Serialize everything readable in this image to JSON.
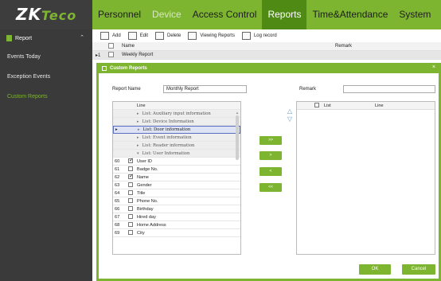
{
  "brand": {
    "logo_main": "ZK",
    "logo_accent": "Teco"
  },
  "topnav": [
    {
      "label": "Personnel",
      "state": "normal"
    },
    {
      "label": "Device",
      "state": "muted"
    },
    {
      "label": "Access Control",
      "state": "normal"
    },
    {
      "label": "Reports",
      "state": "active"
    },
    {
      "label": "Time&Attendance",
      "state": "normal"
    },
    {
      "label": "System",
      "state": "normal"
    }
  ],
  "sidebar": {
    "header": "Report",
    "items": [
      {
        "label": "Events Today",
        "active": false
      },
      {
        "label": "Exception Events",
        "active": false
      },
      {
        "label": "Custom Reports",
        "active": true
      }
    ]
  },
  "toolbar": {
    "add": "Add",
    "edit": "Edit",
    "delete": "Delete",
    "view": "Viewing Reports",
    "log": "Log record"
  },
  "main_table": {
    "headers": {
      "name": "Name",
      "remark": "Remark"
    },
    "rows": [
      {
        "index": "1",
        "name": "Weekly Report",
        "remark": ""
      }
    ]
  },
  "dialog": {
    "title": "Custom Reports",
    "close": "×",
    "report_name_label": "Report Name",
    "report_name_value": "Monthly Report",
    "remark_label": "Remark",
    "remark_value": "",
    "left_grid": {
      "header": "Line",
      "groups": [
        "List: Auxiliary input information",
        "List: Device Information",
        "List: Door information",
        "List: Event information",
        "List: Reader information",
        "List: User Information"
      ],
      "current_group": 2,
      "expanded_group": 5,
      "items": [
        {
          "num": "60",
          "label": "User ID",
          "checked": true
        },
        {
          "num": "61",
          "label": "Badge No.",
          "checked": false
        },
        {
          "num": "62",
          "label": "Name",
          "checked": true
        },
        {
          "num": "63",
          "label": "Gender",
          "checked": false
        },
        {
          "num": "64",
          "label": "Title",
          "checked": false
        },
        {
          "num": "65",
          "label": "Phone No.",
          "checked": false
        },
        {
          "num": "66",
          "label": "Birthday",
          "checked": false
        },
        {
          "num": "67",
          "label": "Hired day",
          "checked": false
        },
        {
          "num": "68",
          "label": "Home Address",
          "checked": false
        },
        {
          "num": "69",
          "label": "City",
          "checked": false
        }
      ]
    },
    "move_buttons": [
      ">>",
      ">",
      "<",
      "<<"
    ],
    "order_up": "△",
    "order_down": "▽",
    "right_grid": {
      "headers": {
        "list": "List",
        "line": "Line"
      }
    },
    "ok": "OK",
    "cancel": "Cancel"
  },
  "colors": {
    "accent": "#7eb530",
    "accent_dark": "#4e8a14",
    "sidebar_bg": "#3a3a3a"
  }
}
